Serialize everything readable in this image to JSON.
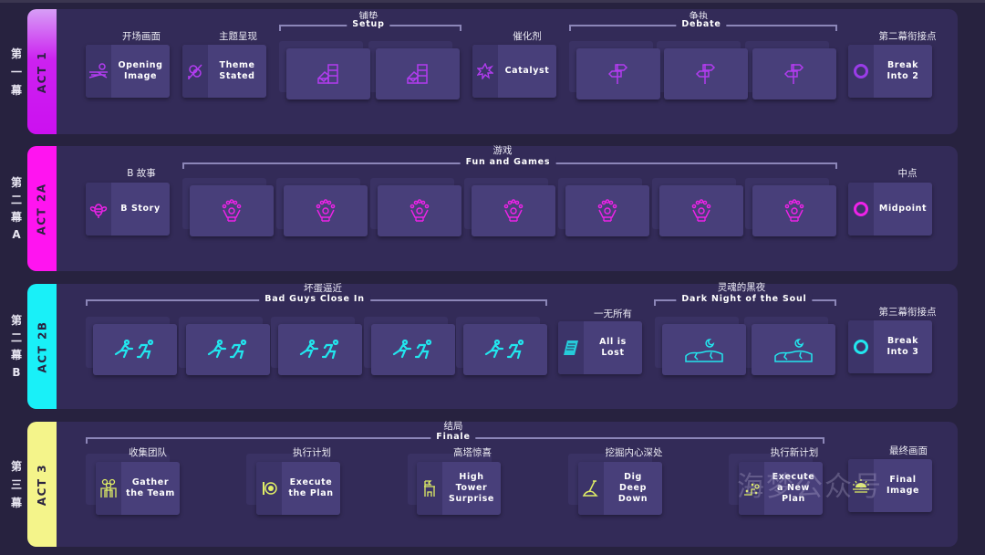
{
  "colors": {
    "act1": "#cc22f0",
    "act2a": "#ff14f0",
    "act2b": "#19f0f8",
    "act3": "#f4f48a",
    "icon1": "#b23cf0",
    "icon2a": "#ee22e8",
    "icon2b": "#22e6ee",
    "icon3": "#e0ee66"
  },
  "rows": [
    {
      "side": [
        "第",
        "一",
        "幕"
      ],
      "tab": "ACT 1",
      "cards": {
        "opening": {
          "cn": "开场画面",
          "en1": "Opening",
          "en2": "Image"
        },
        "theme": {
          "cn": "主题呈现",
          "en1": "Theme",
          "en2": "Stated"
        },
        "catalyst": {
          "cn": "催化剂",
          "en1": "Catalyst"
        },
        "break2": {
          "cn": "第二幕衔接点",
          "en1": "Break",
          "en2": "Into 2"
        }
      },
      "groups": {
        "setup": {
          "cn": "铺垫",
          "en": "Setup"
        },
        "debate": {
          "cn": "争执",
          "en": "Debate"
        }
      }
    },
    {
      "side": [
        "第",
        "二",
        "幕",
        "A"
      ],
      "tab": "ACT 2A",
      "cards": {
        "bstory": {
          "cn": "B 故事",
          "en1": "B Story"
        },
        "midpoint": {
          "cn": "中点",
          "en1": "Midpoint"
        }
      },
      "groups": {
        "fun": {
          "cn": "游戏",
          "en": "Fun and Games"
        }
      }
    },
    {
      "side": [
        "第",
        "二",
        "幕",
        "B"
      ],
      "tab": "ACT 2B",
      "cards": {
        "lost": {
          "cn": "一无所有",
          "en1": "All is",
          "en2": "Lost"
        },
        "break3": {
          "cn": "第三幕衔接点",
          "en1": "Break",
          "en2": "Into 3"
        }
      },
      "groups": {
        "badguys": {
          "cn": "坏蛋逼近",
          "en": "Bad Guys Close In"
        },
        "dark": {
          "cn": "灵魂的黑夜",
          "en": "Dark Night of the Soul"
        }
      }
    },
    {
      "side": [
        "第",
        "三",
        "幕"
      ],
      "tab": "ACT 3",
      "cards": {
        "gather": {
          "cn": "收集团队",
          "en1": "Gather",
          "en2": "the Team"
        },
        "execute": {
          "cn": "执行计划",
          "en1": "Execute",
          "en2": "the Plan"
        },
        "tower": {
          "cn": "高塔惊喜",
          "en1": "High",
          "en2": "Tower",
          "en3": "Surprise"
        },
        "dig": {
          "cn": "挖掘内心深处",
          "en1": "Dig",
          "en2": "Deep",
          "en3": "Down"
        },
        "newplan": {
          "cn": "执行新计划",
          "en1": "Execute",
          "en2": "a New",
          "en3": "Plan"
        },
        "final": {
          "cn": "最终画面",
          "en1": "Final",
          "en2": "Image"
        }
      },
      "groups": {
        "finale": {
          "cn": "结局",
          "en": "Finale"
        }
      }
    }
  ],
  "watermark": "海梦公众号"
}
